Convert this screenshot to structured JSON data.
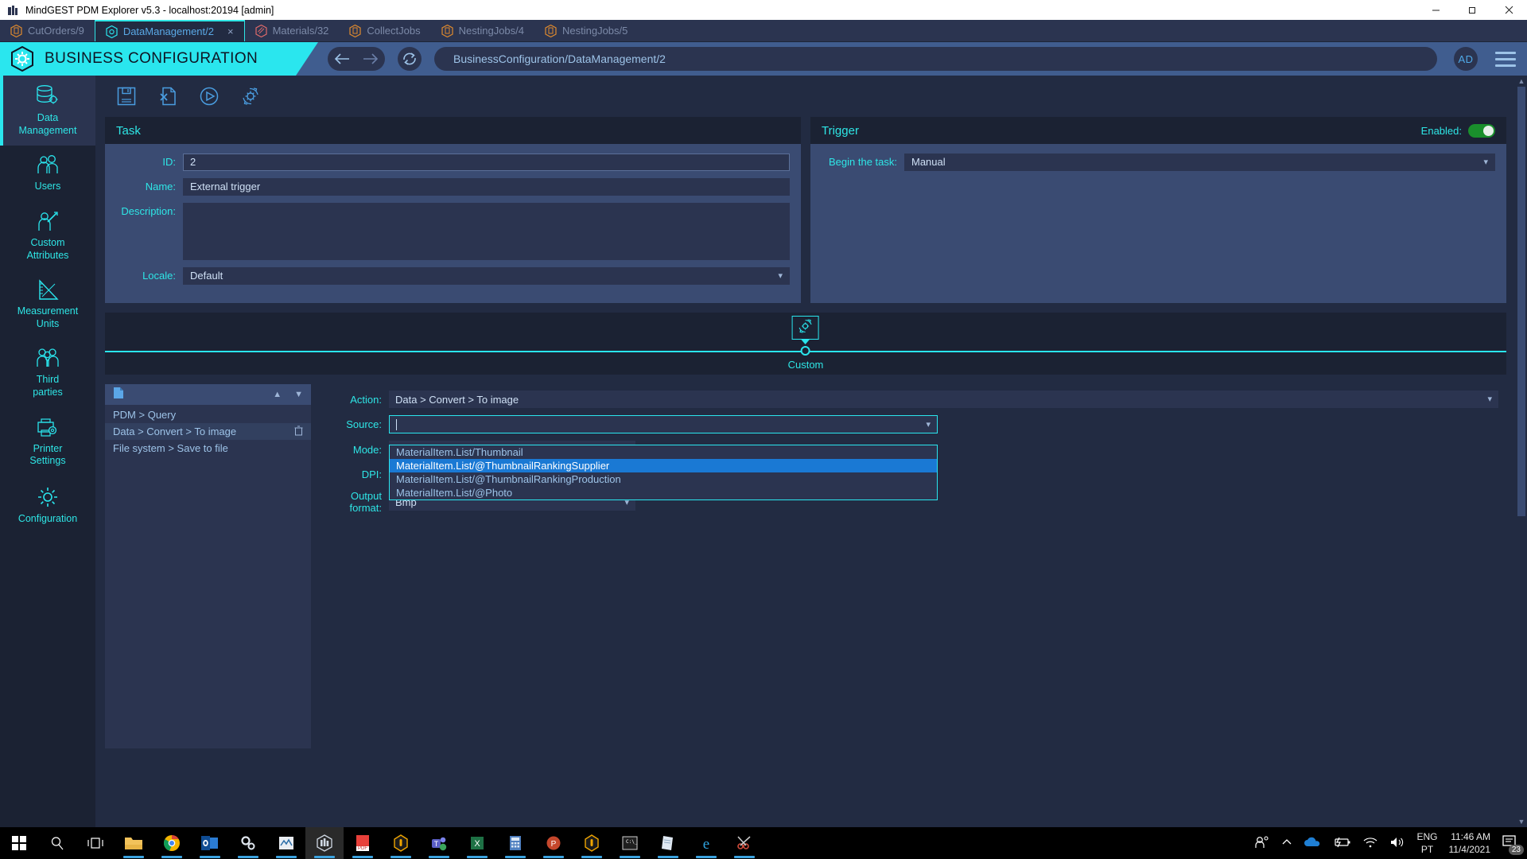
{
  "window": {
    "title": "MindGEST PDM Explorer v5.3 - localhost:20194 [admin]",
    "app_icon": "building-icon",
    "minimize": "minimize-icon",
    "maximize": "maximize-icon",
    "close": "close-icon"
  },
  "tabs": [
    {
      "label": "CutOrders/9",
      "icon": "clipboard-icon",
      "active": false
    },
    {
      "label": "DataManagement/2",
      "icon": "gear-hex-icon",
      "active": true,
      "close": "×"
    },
    {
      "label": "Materials/32",
      "icon": "material-hex-icon",
      "active": false
    },
    {
      "label": "CollectJobs",
      "icon": "clipboard-icon",
      "active": false
    },
    {
      "label": "NestingJobs/4",
      "icon": "clipboard-icon",
      "active": false
    },
    {
      "label": "NestingJobs/5",
      "icon": "clipboard-icon",
      "active": false
    }
  ],
  "header": {
    "title": "BUSINESS CONFIGURATION",
    "logo_icon": "gear-hex-icon",
    "back_icon": "arrow-left-icon",
    "forward_icon": "arrow-right-icon",
    "refresh_icon": "refresh-icon",
    "url": "BusinessConfiguration/DataManagement/2",
    "avatar": "AD",
    "menu_icon": "hamburger-icon"
  },
  "sidebar": {
    "items": [
      {
        "label": "Data\nManagement",
        "icon": "database-gear-icon",
        "active": true
      },
      {
        "label": "Users",
        "icon": "users-icon",
        "active": false
      },
      {
        "label": "Custom\nAttributes",
        "icon": "user-pencil-icon",
        "active": false
      },
      {
        "label": "Measurement\nUnits",
        "icon": "ruler-triangle-icon",
        "active": false
      },
      {
        "label": "Third\nparties",
        "icon": "people-tie-icon",
        "active": false
      },
      {
        "label": "Printer\nSettings",
        "icon": "printer-gear-icon",
        "active": false
      },
      {
        "label": "Configuration",
        "icon": "gear-icon",
        "active": false
      }
    ]
  },
  "toolbar": {
    "buttons": [
      {
        "name": "save-button",
        "icon": "floppy-disk-icon"
      },
      {
        "name": "delete-file-button",
        "icon": "file-x-icon"
      },
      {
        "name": "run-button",
        "icon": "play-circle-icon"
      },
      {
        "name": "configure-button",
        "icon": "gear-refresh-icon"
      }
    ]
  },
  "task_panel": {
    "title": "Task",
    "fields": {
      "id_label": "ID:",
      "id_value": "2",
      "name_label": "Name:",
      "name_value": "External trigger",
      "description_label": "Description:",
      "description_value": "",
      "locale_label": "Locale:",
      "locale_value": "Default"
    }
  },
  "trigger_panel": {
    "title": "Trigger",
    "enabled_label": "Enabled:",
    "enabled": true,
    "begin_label": "Begin the task:",
    "begin_value": "Manual"
  },
  "flow": {
    "node_label": "Custom",
    "node_icon": "gear-refresh-icon"
  },
  "action_list": {
    "file_icon": "file-icon",
    "up_icon": "chevron-up-icon",
    "down_icon": "chevron-down-icon",
    "items": [
      {
        "label": "PDM > Query",
        "selected": false
      },
      {
        "label": "Data > Convert > To image",
        "selected": true,
        "delete_icon": "trash-icon"
      },
      {
        "label": "File system > Save to file",
        "selected": false
      }
    ]
  },
  "action_form": {
    "action_label": "Action:",
    "action_value": "Data > Convert > To image",
    "source_label": "Source:",
    "source_value": "",
    "mode_label": "Mode:",
    "mode_value": "",
    "dpi_label": "DPI:",
    "dpi_value": "",
    "output_label": "Output format:",
    "output_value": "Bmp",
    "dropdown_options": [
      {
        "label": "MaterialItem.List/Thumbnail",
        "highlighted": false
      },
      {
        "label": "MaterialItem.List/@ThumbnailRankingSupplier",
        "highlighted": true
      },
      {
        "label": "MaterialItem.List/@ThumbnailRankingProduction",
        "highlighted": false
      },
      {
        "label": "MaterialItem.List/@Photo",
        "highlighted": false
      }
    ]
  },
  "taskbar": {
    "start_icon": "windows-icon",
    "search_icon": "search-icon",
    "taskview_icon": "task-view-icon",
    "apps": [
      {
        "name": "file-explorer-icon",
        "running": true
      },
      {
        "name": "google-chrome-icon",
        "running": true
      },
      {
        "name": "outlook-icon",
        "running": true
      },
      {
        "name": "settings-gear-icon",
        "running": true
      },
      {
        "name": "media-app-icon",
        "running": true
      },
      {
        "name": "mindgest-icon",
        "running": true,
        "active": true
      },
      {
        "name": "adobe-reader-icon",
        "running": true
      },
      {
        "name": "topsolid-icon",
        "running": true
      },
      {
        "name": "microsoft-teams-icon",
        "running": true
      },
      {
        "name": "excel-icon",
        "running": true
      },
      {
        "name": "calculator-icon",
        "running": true
      },
      {
        "name": "powerpoint-icon",
        "running": true
      },
      {
        "name": "topsolid2-icon",
        "running": true
      },
      {
        "name": "command-prompt-icon",
        "running": true
      },
      {
        "name": "notepad-icon",
        "running": true
      },
      {
        "name": "internet-explorer-icon",
        "running": true
      },
      {
        "name": "snipping-tool-icon",
        "running": true
      }
    ],
    "tray": {
      "people_icon": "people-share-icon",
      "chevron_icon": "chevron-up-icon",
      "onedrive_icon": "onedrive-icon",
      "battery_icon": "battery-charging-icon",
      "network_icon": "wifi-icon",
      "volume_icon": "speaker-icon",
      "lang_line1": "ENG",
      "lang_line2": "PT",
      "time": "11:46 AM",
      "date": "11/4/2021",
      "notifications_icon": "notification-icon",
      "notifications_count": "23"
    }
  }
}
